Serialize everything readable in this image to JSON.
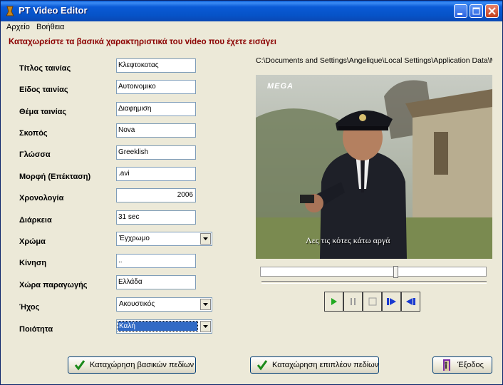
{
  "window": {
    "title": "PT Video Editor"
  },
  "menu": [
    "Αρχείο",
    "Βοήθεια"
  ],
  "instruction": "Καταχωρείστε τα βασικά χαρακτηριστικά του video που έχετε εισάγει",
  "file_path": "C:\\Documents and Settings\\Angelique\\Local Settings\\Application Data\\M",
  "fields": [
    {
      "label": "Τίτλος ταινίας",
      "value": "Κλεφτοκοτας",
      "type": "text"
    },
    {
      "label": "Είδος ταινίας",
      "value": "Αυτοινομικο",
      "type": "text"
    },
    {
      "label": "Θέμα ταινίας",
      "value": "Διαφημιση",
      "type": "text"
    },
    {
      "label": "Σκοπός",
      "value": "Nova",
      "type": "text"
    },
    {
      "label": "Γλώσσα",
      "value": "Greeklish",
      "type": "text"
    },
    {
      "label": "Μορφή (Επέκταση)",
      "value": ".avi",
      "type": "text"
    },
    {
      "label": "Χρονολογία",
      "value": "2006",
      "type": "text"
    },
    {
      "label": "Διάρκεια",
      "value": "31 sec",
      "type": "text"
    },
    {
      "label": "Χρώμα",
      "value": "Έγχρωμο",
      "type": "combo"
    },
    {
      "label": "Κίνηση",
      "value": "..",
      "type": "text"
    },
    {
      "label": "Χώρα παραγωγής",
      "value": "Ελλάδα",
      "type": "text"
    },
    {
      "label": "Ήχος",
      "value": "Ακουστικός",
      "type": "combo"
    },
    {
      "label": "Ποιότητα",
      "value": "Καλή",
      "type": "combo"
    }
  ],
  "video": {
    "watermark": "MEGA",
    "subtitle": "Λες τις κότες κάτω αργά"
  },
  "player": {
    "position": 0.6,
    "icons": [
      "play-icon",
      "pause-icon",
      "stop-icon",
      "step-forward-icon",
      "step-back-icon"
    ]
  },
  "buttons": {
    "save_basic": "Καταχώρηση βασικών πεδίων",
    "save_extra": "Καταχώρηση επιπλέον πεδίων",
    "exit": "Έξοδος"
  },
  "colors": {
    "title_bar": "#0a5ad6",
    "instruction": "#8b0000",
    "selection": "#316ac5",
    "play": "#22aa22",
    "nav": "#1a3ad0"
  }
}
